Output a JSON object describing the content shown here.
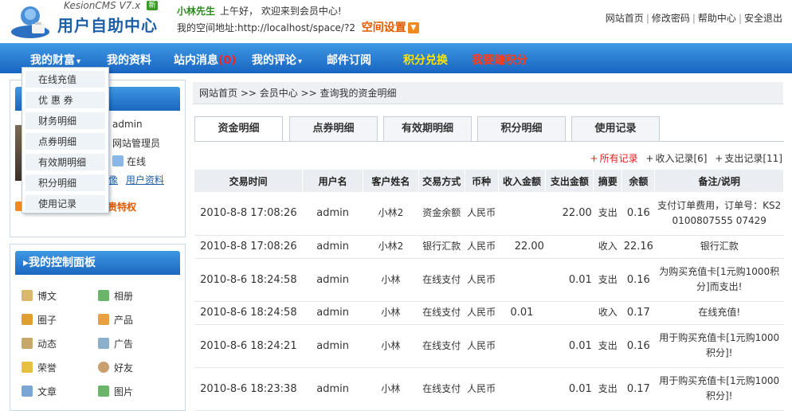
{
  "header": {
    "brand": "KesionCMS V7.x",
    "new_badge": "新",
    "title": "用户自助中心",
    "username": "小林先生",
    "greeting": "上午好， 欢迎来到会员中心!",
    "space_label": "我的空间地址:",
    "space_url": "http://localhost/space/?2",
    "space_settings": "空间设置",
    "links": [
      "网站首页",
      "修改密码",
      "帮助中心",
      "安全退出"
    ]
  },
  "nav": {
    "items": [
      {
        "label": "我的财富",
        "caret": "▾"
      },
      {
        "label": "我的资料"
      },
      {
        "label": "站内消息",
        "badge": "(0)"
      },
      {
        "label": "我的评论",
        "caret": "▾"
      },
      {
        "label": "邮件订阅"
      },
      {
        "label": "积分兑换"
      },
      {
        "label": "我要赚积分"
      }
    ]
  },
  "dropdown": {
    "items": [
      "在线充值",
      "优 惠 券",
      "财务明细",
      "点券明细",
      "有效期明细",
      "积分明细",
      "使用记录"
    ]
  },
  "user_panel": {
    "name": "admin",
    "group": "网站管理员",
    "status": "在线",
    "link_avatar": "像",
    "link_profile": "用户资料",
    "vip": "卫车开级会员 安尊贵特权"
  },
  "control_panel": {
    "title": "我的控制面板",
    "items": [
      "博文",
      "相册",
      "圈子",
      "产品",
      "动态",
      "广告",
      "荣誉",
      "好友",
      "文章",
      "图片"
    ]
  },
  "breadcrumb": "网站首页 >> 会员中心 >> 查询我的资金明细",
  "tabs": [
    "资金明细",
    "点券明细",
    "有效期明细",
    "积分明细",
    "使用记录"
  ],
  "filters": {
    "all": "所有记录",
    "income": "收入记录[6]",
    "expense": "支出记录[11]"
  },
  "table": {
    "headers": [
      "交易时间",
      "用户名",
      "客户姓名",
      "交易方式",
      "币种",
      "收入金额",
      "支出金额",
      "摘要",
      "余额",
      "备注/说明"
    ],
    "rows": [
      {
        "time": "2010-8-8 17:08:26",
        "user": "admin",
        "customer": "小林2",
        "method": "资金余额",
        "currency": "人民币",
        "income": "",
        "expense": "22.00",
        "summary": "支出",
        "balance": "0.16",
        "note": "支付订单费用，订单号：KS20100807555 07429"
      },
      {
        "time": "2010-8-8 17:08:26",
        "user": "admin",
        "customer": "小林2",
        "method": "银行汇款",
        "currency": "人民币",
        "income": "22.00",
        "expense": "",
        "summary": "收入",
        "balance": "22.16",
        "note": "银行汇款"
      },
      {
        "time": "2010-8-6 18:24:58",
        "user": "admin",
        "customer": "小林",
        "method": "在线支付",
        "currency": "人民币",
        "income": "",
        "expense": "0.01",
        "summary": "支出",
        "balance": "0.16",
        "note": "为购买充值卡[1元购1000积分]而支出!"
      },
      {
        "time": "2010-8-6 18:24:58",
        "user": "admin",
        "customer": "小林",
        "method": "在线支付",
        "currency": "人民币",
        "income": "0.01",
        "expense": "",
        "summary": "收入",
        "balance": "0.17",
        "note": "在线充值!"
      },
      {
        "time": "2010-8-6 18:24:21",
        "user": "admin",
        "customer": "小林",
        "method": "在线支付",
        "currency": "人民币",
        "income": "",
        "expense": "0.01",
        "summary": "支出",
        "balance": "0.16",
        "note": "用于购买充值卡[1元购1000积分]!"
      },
      {
        "time": "2010-8-6 18:23:38",
        "user": "admin",
        "customer": "小林",
        "method": "在线支付",
        "currency": "人民币",
        "income": "",
        "expense": "0.01",
        "summary": "支出",
        "balance": "0.17",
        "note": "用于购买充值卡[1元购1000积分]!"
      }
    ]
  }
}
